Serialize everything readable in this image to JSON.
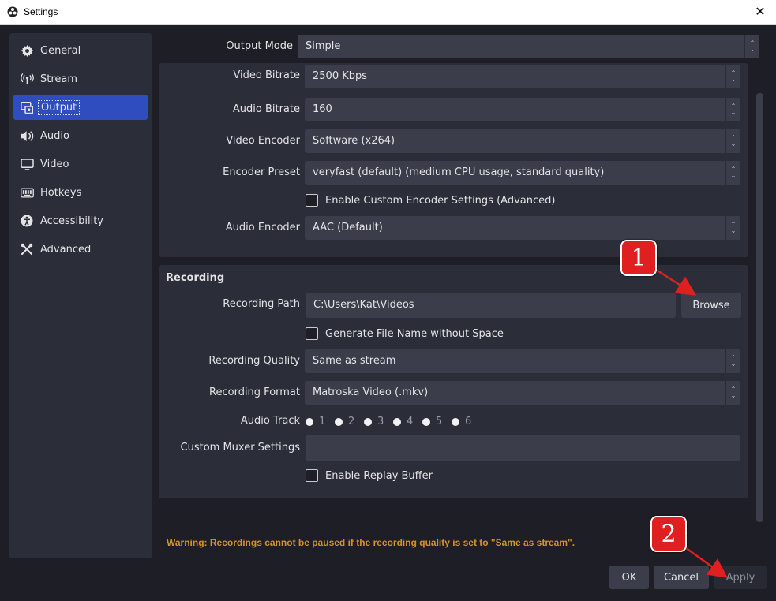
{
  "window": {
    "title": "Settings",
    "close_glyph": "✕"
  },
  "sidebar": {
    "items": [
      {
        "label": "General",
        "icon": "gear-icon"
      },
      {
        "label": "Stream",
        "icon": "antenna-icon"
      },
      {
        "label": "Output",
        "icon": "output-icon",
        "active": true
      },
      {
        "label": "Audio",
        "icon": "speaker-icon"
      },
      {
        "label": "Video",
        "icon": "monitor-icon"
      },
      {
        "label": "Hotkeys",
        "icon": "keyboard-icon"
      },
      {
        "label": "Accessibility",
        "icon": "accessibility-icon"
      },
      {
        "label": "Advanced",
        "icon": "tools-icon"
      }
    ]
  },
  "output_mode": {
    "label": "Output Mode",
    "value": "Simple"
  },
  "streaming": {
    "video_bitrate": {
      "label": "Video Bitrate",
      "value": "2500 Kbps"
    },
    "audio_bitrate": {
      "label": "Audio Bitrate",
      "value": "160"
    },
    "video_encoder": {
      "label": "Video Encoder",
      "value": "Software (x264)"
    },
    "encoder_preset": {
      "label": "Encoder Preset",
      "value": "veryfast (default) (medium CPU usage, standard quality)"
    },
    "custom_encoder": {
      "label": "Enable Custom Encoder Settings (Advanced)",
      "checked": false
    },
    "audio_encoder": {
      "label": "Audio Encoder",
      "value": "AAC (Default)"
    }
  },
  "recording": {
    "header": "Recording",
    "path": {
      "label": "Recording Path",
      "value": "C:\\Users\\Kat\\Videos"
    },
    "browse_label": "Browse",
    "gen_filename": {
      "label": "Generate File Name without Space",
      "checked": false
    },
    "quality": {
      "label": "Recording Quality",
      "value": "Same as stream"
    },
    "format": {
      "label": "Recording Format",
      "value": "Matroska Video (.mkv)"
    },
    "audio_track": {
      "label": "Audio Track",
      "tracks": [
        "1",
        "2",
        "3",
        "4",
        "5",
        "6"
      ]
    },
    "muxer": {
      "label": "Custom Muxer Settings",
      "value": ""
    },
    "replay_buffer": {
      "label": "Enable Replay Buffer",
      "checked": false
    }
  },
  "warning": "Warning: Recordings cannot be paused if the recording quality is set to \"Same as stream\".",
  "buttons": {
    "ok": "OK",
    "cancel": "Cancel",
    "apply": "Apply"
  },
  "annotations": {
    "badge1": "1",
    "badge2": "2",
    "color": "#e02020"
  }
}
